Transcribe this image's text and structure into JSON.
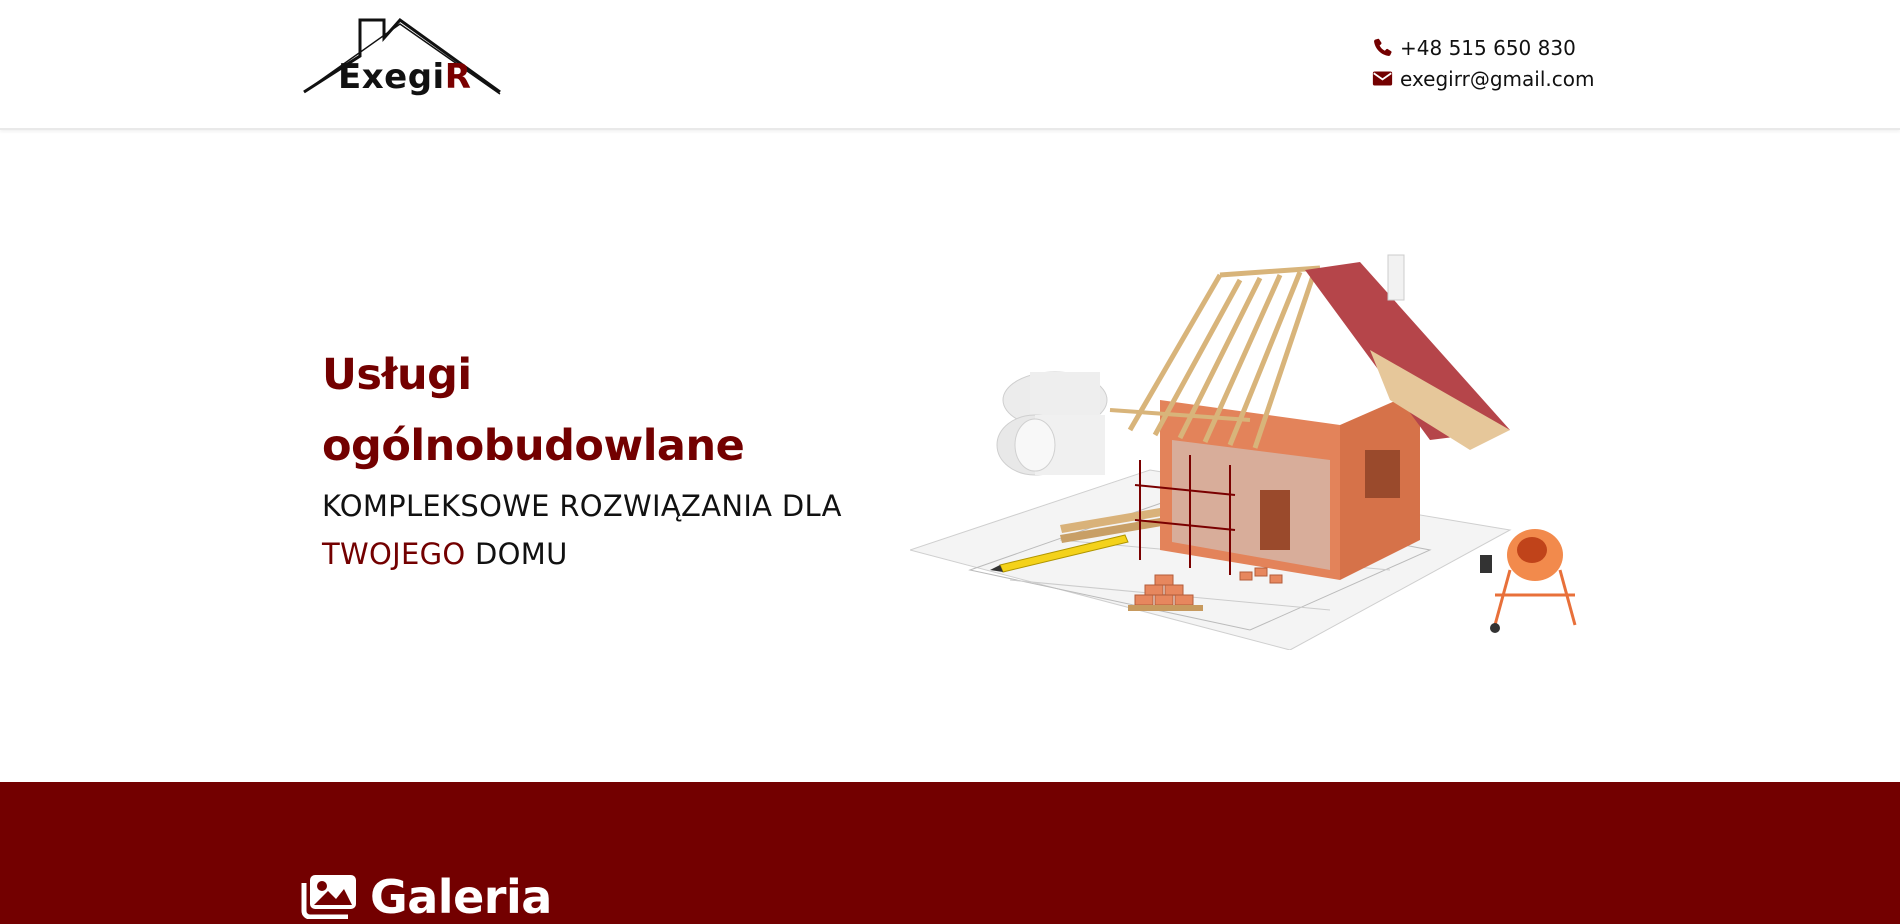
{
  "header": {
    "logo": {
      "name": "ExegiR",
      "text_main": "Exegi",
      "text_accent": "R"
    },
    "phone": {
      "icon": "phone-icon",
      "text": "+48 515 650 830"
    },
    "email": {
      "icon": "envelope-icon",
      "text": "exegirr@gmail.com"
    }
  },
  "hero": {
    "title_line1": "Usługi",
    "title_line2": "ogólnobudowlane",
    "subtitle_line1": "KOMPLEKSOWE ROZWIĄZANIA DLA",
    "subtitle_accent": "TWOJEGO",
    "subtitle_rest": " DOMU",
    "image": "house-under-construction-illustration"
  },
  "gallery": {
    "icon": "images-icon",
    "title": "Galeria"
  },
  "colors": {
    "brand": "#730000",
    "text": "#111111",
    "background": "#ffffff"
  }
}
